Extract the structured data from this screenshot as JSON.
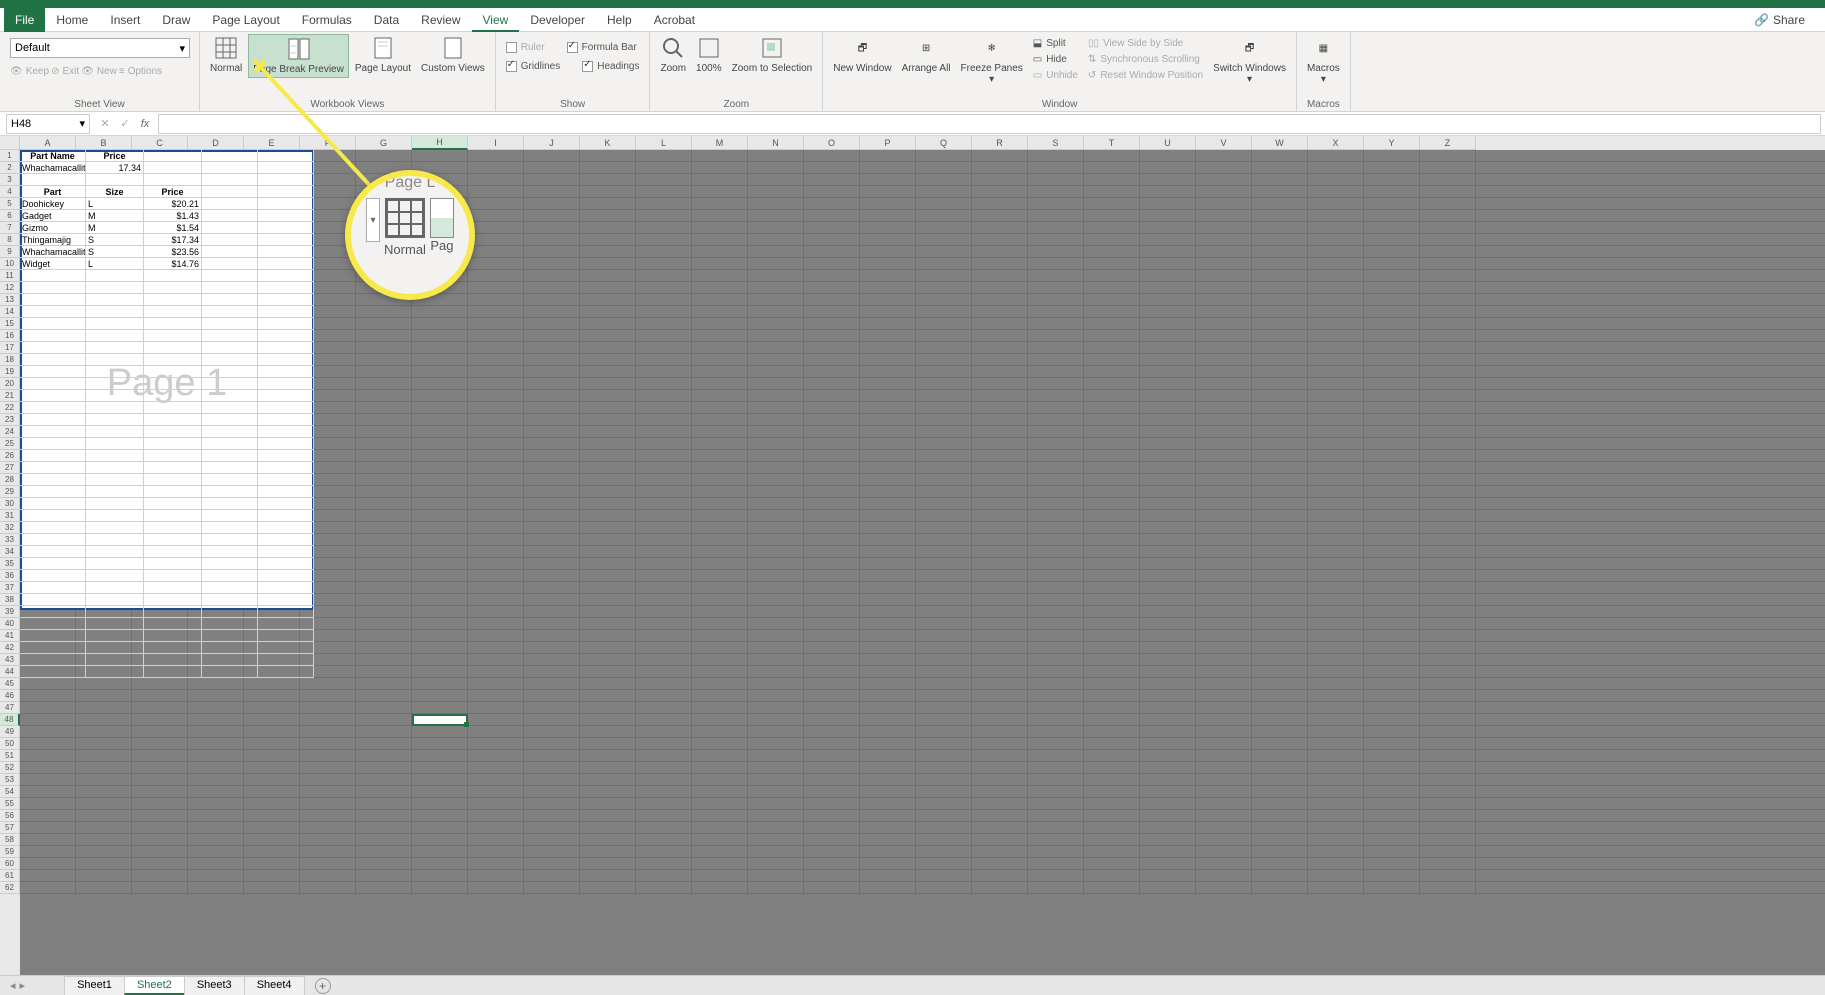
{
  "tabs": {
    "file": "File",
    "home": "Home",
    "insert": "Insert",
    "draw": "Draw",
    "pageLayout": "Page Layout",
    "formulas": "Formulas",
    "data": "Data",
    "review": "Review",
    "view": "View",
    "developer": "Developer",
    "help": "Help",
    "acrobat": "Acrobat",
    "share": "Share"
  },
  "sheetView": {
    "default_label": "Default",
    "keep": "Keep",
    "exit": "Exit",
    "new": "New",
    "options": "Options",
    "group_label": "Sheet View"
  },
  "workbookViews": {
    "normal": "Normal",
    "pageBreak": "Page Break Preview",
    "pageLayout": "Page Layout",
    "custom": "Custom Views",
    "group_label": "Workbook Views"
  },
  "show": {
    "ruler": "Ruler",
    "formulaBar": "Formula Bar",
    "gridlines": "Gridlines",
    "headings": "Headings",
    "group_label": "Show"
  },
  "zoom": {
    "zoom": "Zoom",
    "hundred": "100%",
    "toSelection": "Zoom to Selection",
    "group_label": "Zoom"
  },
  "window": {
    "newWindow": "New Window",
    "arrangeAll": "Arrange All",
    "freezePanes": "Freeze Panes",
    "split": "Split",
    "hide": "Hide",
    "unhide": "Unhide",
    "viewSide": "View Side by Side",
    "sync": "Synchronous Scrolling",
    "reset": "Reset Window Position",
    "switch": "Switch Windows",
    "group_label": "Window"
  },
  "macros": {
    "macros": "Macros",
    "group_label": "Macros"
  },
  "nameBox": "H48",
  "columns": [
    "A",
    "B",
    "C",
    "D",
    "E",
    "F",
    "G",
    "H",
    "I",
    "J",
    "K",
    "L",
    "M",
    "N",
    "O",
    "P",
    "Q",
    "R",
    "S",
    "T",
    "U",
    "V",
    "W",
    "X",
    "Y",
    "Z"
  ],
  "selectedColumn": "H",
  "selectedRow": 48,
  "pageWatermark": "Page 1",
  "sheetData": {
    "header1": [
      "Part Name",
      "Price"
    ],
    "row2": [
      "Whachamacallit",
      "17.34"
    ],
    "header4": [
      "Part",
      "Size",
      "Price"
    ],
    "rows": [
      [
        "Doohickey",
        "L",
        "$20.21"
      ],
      [
        "Gadget",
        "M",
        "$1.43"
      ],
      [
        "Gizmo",
        "M",
        "$1.54"
      ],
      [
        "Thingamajig",
        "S",
        "$17.34"
      ],
      [
        "Whachamacallit",
        "S",
        "$23.56"
      ],
      [
        "Widget",
        "L",
        "$14.76"
      ]
    ]
  },
  "sheetTabs": [
    "Sheet1",
    "Sheet2",
    "Sheet3",
    "Sheet4"
  ],
  "activeSheet": "Sheet2",
  "magnify": {
    "title": "Page L",
    "normal": "Normal",
    "page": "Pag"
  }
}
